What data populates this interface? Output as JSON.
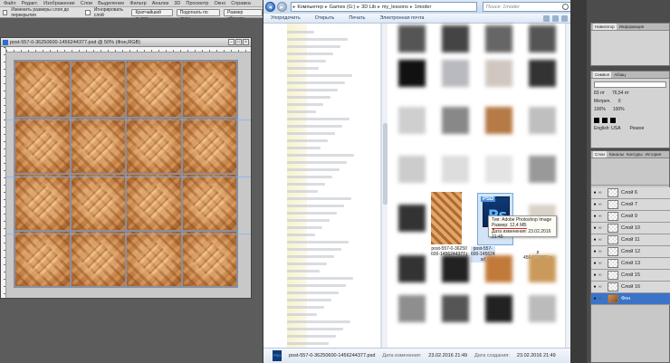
{
  "photoshop": {
    "menu": [
      "Файл",
      "Редакт.",
      "Изображение",
      "Слои",
      "Выделение",
      "Фильтр",
      "Анализ",
      "3D",
      "Просмотр",
      "Окно",
      "Справка"
    ],
    "options": {
      "snap_label": "Изменить размеры слоя до перекрытия",
      "align_btn": "Игнорировать слой",
      "b1": "Кратчайший выход",
      "b2": "Подогнать по краю...",
      "b3": "Размер области..."
    },
    "doc_title": "post-557-0-36250600-1456244377.psd @ 50% (Фон,RGB)",
    "tile_rows": 4,
    "tile_cols": 4,
    "layers_panel": {
      "tabs": [
        "Слои",
        "Каналы",
        "Контуры",
        "История"
      ],
      "layers": [
        "Слой 6",
        "Слой 7",
        "Слой 9",
        "Слой 10",
        "Слой 11",
        "Слой 12",
        "Слой 13",
        "Слой 15",
        "Слой 16",
        "Фон"
      ]
    },
    "top_panels": {
      "nav_tabs": [
        "Навигатор",
        "Информация"
      ],
      "char_tabs": [
        "Символ",
        "Абзац"
      ],
      "font_size": "83 пт",
      "leading": "76,54 пт",
      "tracking": "0",
      "scale_v": "100%",
      "scale_h": "100%",
      "lang": "English: USA",
      "aa": "Резкое"
    }
  },
  "explorer": {
    "breadcrumb": [
      "Компьютер",
      "Games (G:)",
      "3D Lib",
      "my_lessons",
      "1moder"
    ],
    "search_placeholder": "Поиск: 1moder",
    "toolbar": [
      "Упорядочить",
      "Открыть",
      "Печать",
      "Электронная почта"
    ],
    "files": [
      {
        "name": "post-557-0-36250600-1456244377.jpg",
        "label": "post-557-0-36250\n600-1456244377.j\npg"
      },
      {
        "name": "post-557-0-36250600-1456244377.psd",
        "label": "post-557-\n600-145624\nsd"
      },
      {
        "name": "post-557-0-14564773953.png",
        "label": "p\n4564773953.p\nng"
      }
    ],
    "tooltip": {
      "type": "Тип: Adobe Photoshop Image",
      "size": "Размер: 12,4 МБ",
      "modified": "Дата изменения: 23.02.2016 21:49"
    },
    "details": {
      "file": "post-557-0-36250600-1456244377.psd",
      "modified_label": "Дата изменения:",
      "modified": "23.02.2016 21:49",
      "created_label": "Дата создания:",
      "created": "23.02.2016 21:49",
      "type": "Adobe Photoshop Image"
    }
  },
  "colors": {
    "layer_selected": "#3a73c8",
    "tooltip_underline": "#e0231f",
    "psd_icon": "#0f3a78"
  }
}
